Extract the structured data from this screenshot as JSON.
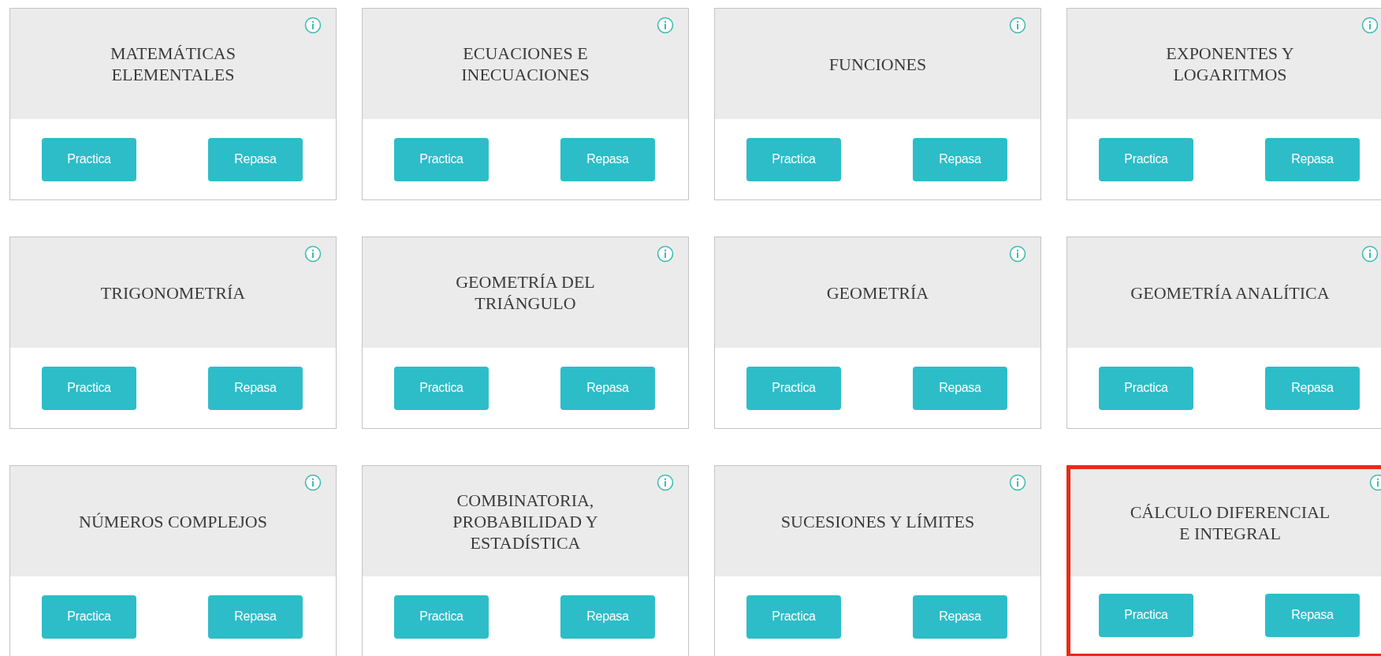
{
  "cards": [
    {
      "title_lines": [
        "MATEMÁTICAS",
        "ELEMENTALES"
      ],
      "buttons": [
        "Practica",
        "Repasa"
      ],
      "highlighted": false
    },
    {
      "title_lines": [
        "ECUACIONES E",
        "INECUACIONES"
      ],
      "buttons": [
        "Practica",
        "Repasa"
      ],
      "highlighted": false
    },
    {
      "title_lines": [
        "FUNCIONES"
      ],
      "buttons": [
        "Practica",
        "Repasa"
      ],
      "highlighted": false
    },
    {
      "title_lines": [
        "EXPONENTES Y",
        "LOGARITMOS"
      ],
      "buttons": [
        "Practica",
        "Repasa"
      ],
      "highlighted": false
    },
    {
      "title_lines": [
        "TRIGONOMETRÍA"
      ],
      "buttons": [
        "Practica",
        "Repasa"
      ],
      "highlighted": false
    },
    {
      "title_lines": [
        "GEOMETRÍA DEL",
        "TRIÁNGULO"
      ],
      "buttons": [
        "Practica",
        "Repasa"
      ],
      "highlighted": false
    },
    {
      "title_lines": [
        "GEOMETRÍA"
      ],
      "buttons": [
        "Practica",
        "Repasa"
      ],
      "highlighted": false
    },
    {
      "title_lines": [
        "GEOMETRÍA ANALÍTICA"
      ],
      "buttons": [
        "Practica",
        "Repasa"
      ],
      "highlighted": false
    },
    {
      "title_lines": [
        "NÚMEROS COMPLEJOS"
      ],
      "buttons": [
        "Practica",
        "Repasa"
      ],
      "highlighted": false
    },
    {
      "title_lines": [
        "COMBINATORIA,",
        "PROBABILIDAD Y",
        "ESTADÍSTICA"
      ],
      "buttons": [
        "Practica",
        "Repasa"
      ],
      "highlighted": false
    },
    {
      "title_lines": [
        "SUCESIONES Y LÍMITES"
      ],
      "buttons": [
        "Practica",
        "Repasa"
      ],
      "highlighted": false
    },
    {
      "title_lines": [
        "CÁLCULO DIFERENCIAL",
        "E INTEGRAL"
      ],
      "buttons": [
        "Practica",
        "Repasa"
      ],
      "highlighted": true
    }
  ]
}
